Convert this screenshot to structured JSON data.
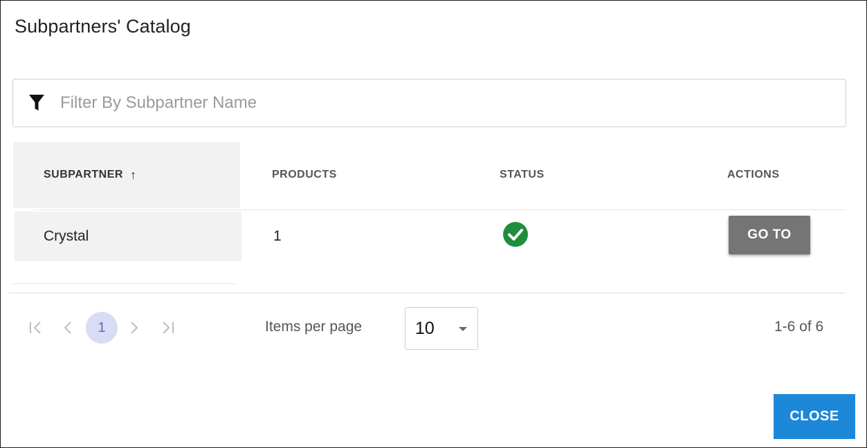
{
  "dialog": {
    "title": "Subpartners' Catalog"
  },
  "filter": {
    "placeholder": "Filter By Subpartner Name",
    "value": "",
    "icon": "filter-icon"
  },
  "table": {
    "columns": [
      {
        "label": "SUBPARTNER",
        "sorted": "ascending",
        "sort_icon": "arrow-up-icon"
      },
      {
        "label": "PRODUCTS"
      },
      {
        "label": "STATUS"
      },
      {
        "label": "ACTIONS"
      }
    ],
    "rows": [
      {
        "subpartner": "Crystal",
        "products": "1",
        "status_icon": "check-circle-icon",
        "status_color": "#1e8e3e",
        "action_label": "GO TO"
      }
    ]
  },
  "pagination": {
    "current_page": "1",
    "items_per_page_label": "Items per page",
    "items_per_page_value": "10",
    "range_label": "1-6 of 6"
  },
  "footer": {
    "close_label": "CLOSE"
  },
  "colors": {
    "accent": "#1e88d8",
    "goto_button": "#757575",
    "page_highlight": "#d9dcf3"
  }
}
